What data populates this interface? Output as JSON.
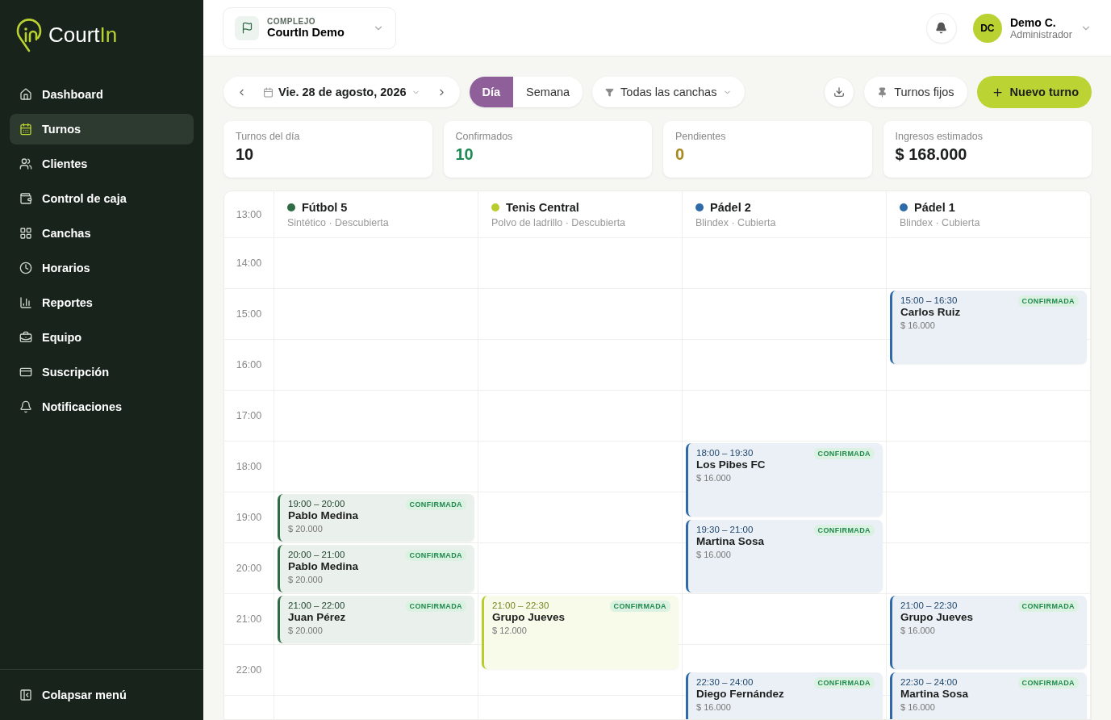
{
  "logo": {
    "text": "Court",
    "accent": "In"
  },
  "sidebar": {
    "items": [
      {
        "label": "Dashboard",
        "selected": false
      },
      {
        "label": "Turnos",
        "selected": true
      },
      {
        "label": "Clientes",
        "selected": false
      },
      {
        "label": "Control de caja",
        "selected": false
      },
      {
        "label": "Canchas",
        "selected": false
      },
      {
        "label": "Horarios",
        "selected": false
      },
      {
        "label": "Reportes",
        "selected": false
      },
      {
        "label": "Equipo",
        "selected": false
      },
      {
        "label": "Suscripción",
        "selected": false
      },
      {
        "label": "Notificaciones",
        "selected": false
      }
    ],
    "collapse": "Colapsar menú"
  },
  "complex": {
    "label": "COMPLEJO",
    "name": "CourtIn Demo"
  },
  "user": {
    "initials": "DC",
    "name": "Demo C.",
    "role": "Administrador"
  },
  "toolbar": {
    "date": "Vie. 28 de agosto, 2026",
    "views": [
      {
        "label": "Día",
        "selected": true
      },
      {
        "label": "Semana",
        "selected": false
      }
    ],
    "filter": "Todas las canchas",
    "fixed": "Turnos fijos",
    "new": "Nuevo turno"
  },
  "stats": [
    {
      "label": "Turnos del día",
      "value": "10",
      "color": "#1c1f1d"
    },
    {
      "label": "Confirmados",
      "value": "10",
      "color": "#1e8a55"
    },
    {
      "label": "Pendientes",
      "value": "0",
      "color": "#a8891f"
    },
    {
      "label": "Ingresos estimados",
      "value": "$ 168.000",
      "color": "#1c1f1d"
    }
  ],
  "hours": [
    "13:00",
    "14:00",
    "15:00",
    "16:00",
    "17:00",
    "18:00",
    "19:00",
    "20:00",
    "21:00",
    "22:00"
  ],
  "courts": [
    {
      "name": "Fútbol 5",
      "detail": "Sintético · Descubierta",
      "color": "#2f6b45",
      "events": [
        {
          "time": "19:00 – 20:00",
          "client": "Pablo Medina",
          "price": "$ 20.000",
          "status": "CONFIRMADA"
        },
        {
          "time": "20:00 – 21:00",
          "client": "Pablo Medina",
          "price": "$ 20.000",
          "status": "CONFIRMADA"
        },
        {
          "time": "21:00 – 22:00",
          "client": "Juan Pérez",
          "price": "$ 20.000",
          "status": "CONFIRMADA"
        }
      ]
    },
    {
      "name": "Tenis Central",
      "detail": "Polvo de ladrillo · Descubierta",
      "color": "#b9cc2e",
      "events": [
        {
          "time": "21:00 – 22:30",
          "client": "Grupo Jueves",
          "price": "$ 12.000",
          "status": "CONFIRMADA"
        }
      ]
    },
    {
      "name": "Pádel 2",
      "detail": "Blindex · Cubierta",
      "color": "#2f6aa8",
      "events": [
        {
          "time": "18:00 – 19:30",
          "client": "Los Pibes FC",
          "price": "$ 16.000",
          "status": "CONFIRMADA"
        },
        {
          "time": "19:30 – 21:00",
          "client": "Martina Sosa",
          "price": "$ 16.000",
          "status": "CONFIRMADA"
        },
        {
          "time": "22:30 – 24:00",
          "client": "Diego Fernández",
          "price": "$ 16.000",
          "status": "CONFIRMADA"
        }
      ]
    },
    {
      "name": "Pádel 1",
      "detail": "Blindex · Cubierta",
      "color": "#2f6aa8",
      "events": [
        {
          "time": "15:00 – 16:30",
          "client": "Carlos Ruiz",
          "price": "$ 16.000",
          "status": "CONFIRMADA"
        },
        {
          "time": "21:00 – 22:30",
          "client": "Grupo Jueves",
          "price": "$ 16.000",
          "status": "CONFIRMADA"
        },
        {
          "time": "22:30 – 24:00",
          "client": "Martina Sosa",
          "price": "$ 16.000",
          "status": "CONFIRMADA"
        }
      ]
    }
  ]
}
